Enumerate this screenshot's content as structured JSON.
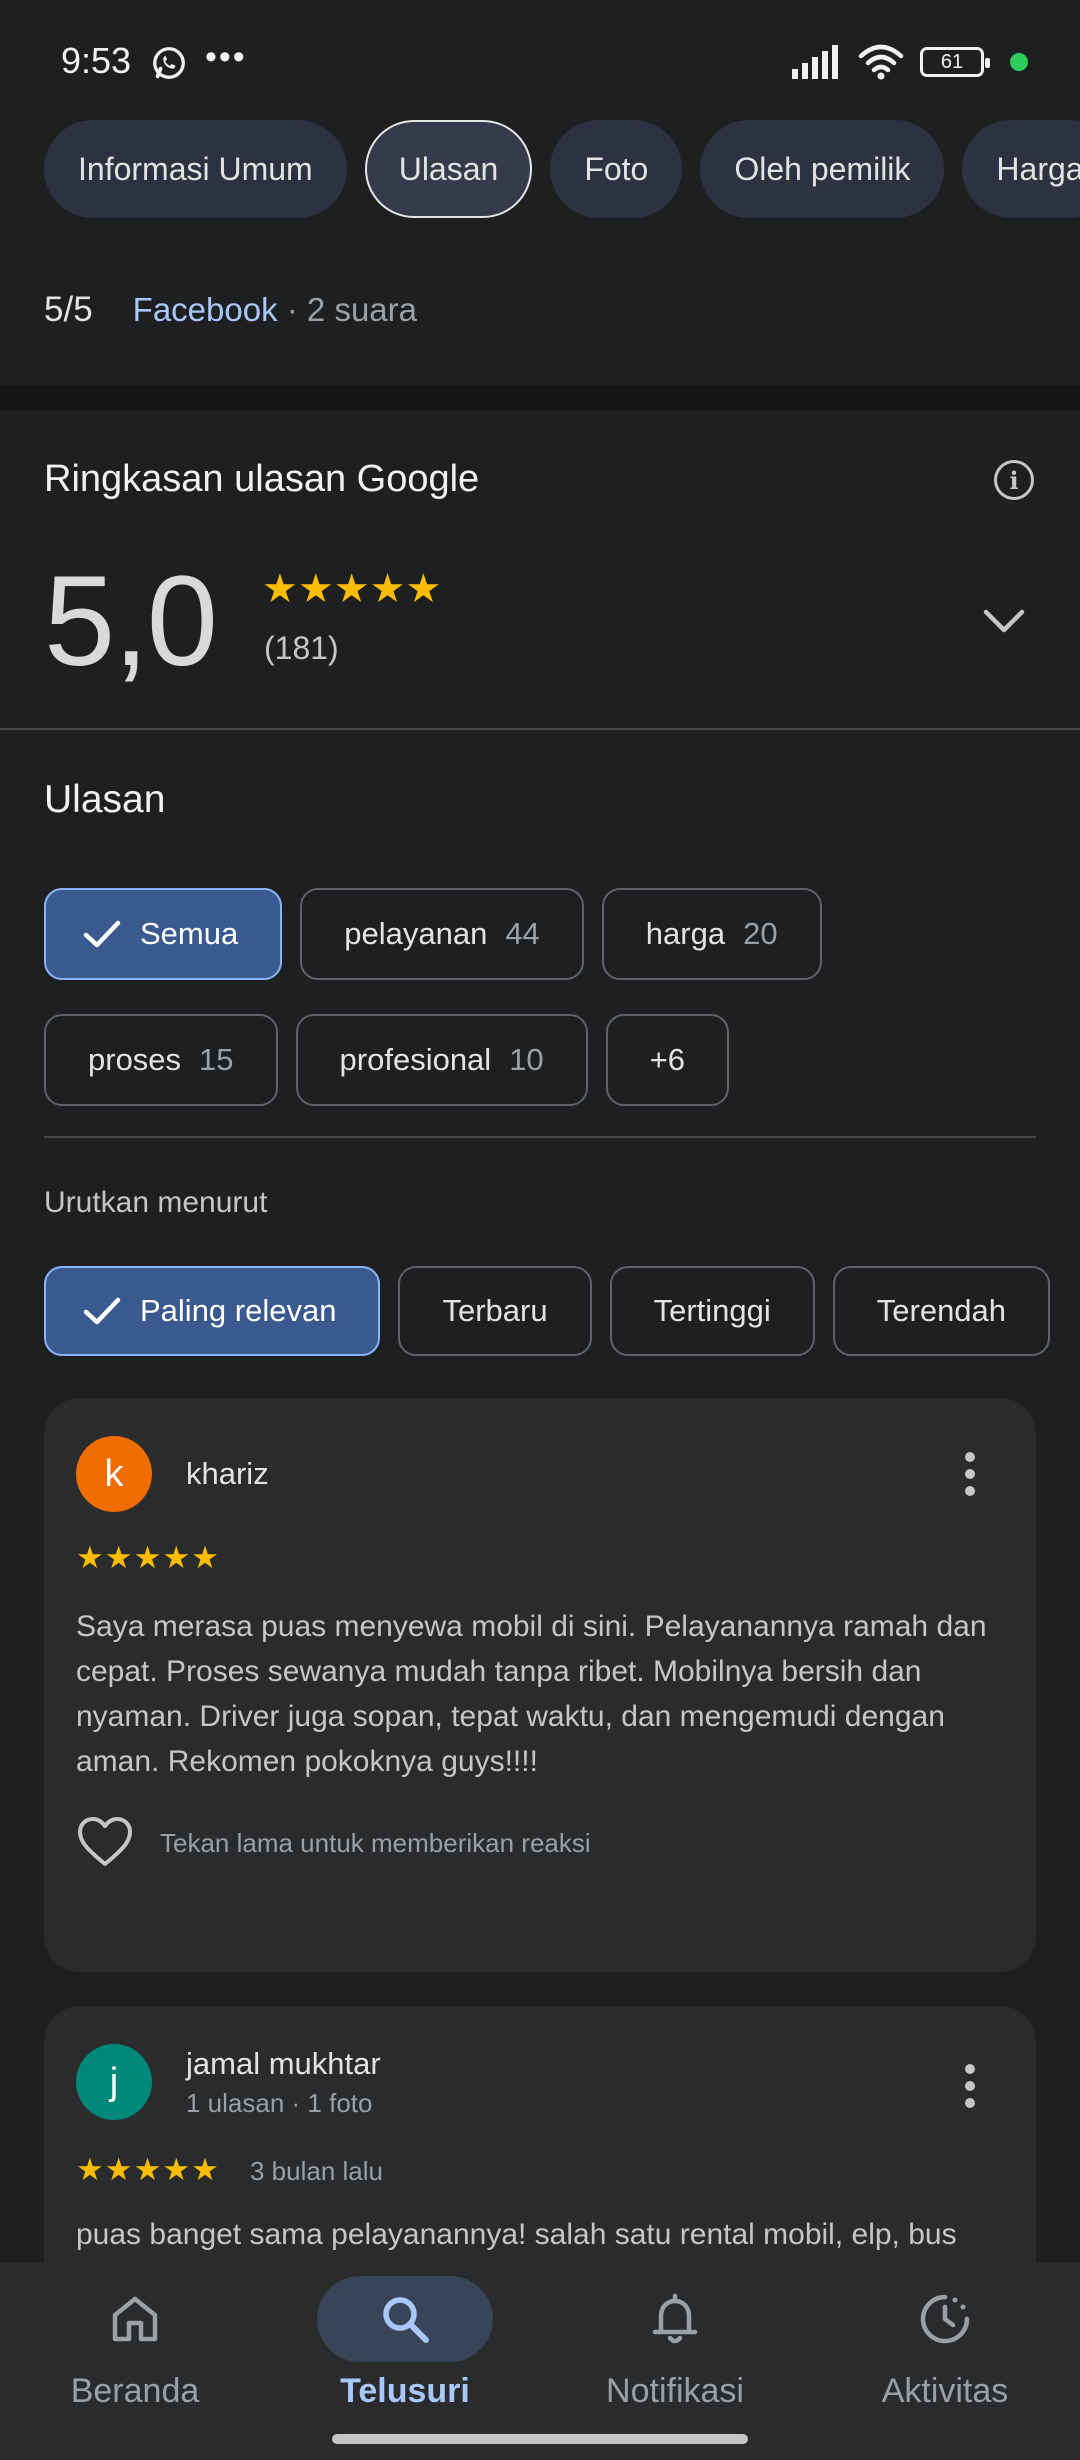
{
  "status": {
    "time": "9:53",
    "battery": "61"
  },
  "tabs": [
    {
      "label": "Informasi Umum"
    },
    {
      "label": "Ulasan"
    },
    {
      "label": "Foto"
    },
    {
      "label": "Oleh pemilik"
    },
    {
      "label": "Harga"
    }
  ],
  "external_rating": {
    "score": "5/5",
    "source": "Facebook",
    "votes": " · 2 suara"
  },
  "summary": {
    "title": "Ringkasan ulasan Google",
    "rating": "5,0",
    "stars": "★★★★★",
    "count": "(181)"
  },
  "reviews_section": {
    "title": "Ulasan",
    "topics": [
      {
        "label": "Semua",
        "count": ""
      },
      {
        "label": "pelayanan",
        "count": "44"
      },
      {
        "label": "harga",
        "count": "20"
      },
      {
        "label": "proses",
        "count": "15"
      },
      {
        "label": "profesional",
        "count": "10"
      },
      {
        "label": "+6",
        "count": ""
      }
    ],
    "sort_label": "Urutkan menurut",
    "sort_options": [
      {
        "label": "Paling relevan"
      },
      {
        "label": "Terbaru"
      },
      {
        "label": "Tertinggi"
      },
      {
        "label": "Terendah"
      }
    ]
  },
  "reviews": [
    {
      "initial": "k",
      "avatar_color": "#ef6c00",
      "name": "khariz",
      "stars": "★★★★★",
      "text": "Saya merasa puas menyewa mobil di sini. Pelayanannya ramah dan cepat. Proses sewanya mudah tanpa ribet. Mobilnya bersih dan nyaman. Driver juga sopan, tepat waktu, dan mengemudi dengan aman. Rekomen pokoknya guys!!!!",
      "react_hint": "Tekan lama untuk memberikan reaksi"
    },
    {
      "initial": "j",
      "avatar_color": "#00897b",
      "name": "jamal mukhtar",
      "meta": "1 ulasan · 1 foto",
      "stars": "★★★★★",
      "time": "3 bulan lalu",
      "text": "puas banget sama pelayanannya! salah satu rental mobil, elp, bus"
    }
  ],
  "bottom_nav": [
    {
      "label": "Beranda",
      "icon": "home-icon"
    },
    {
      "label": "Telusuri",
      "icon": "search-icon"
    },
    {
      "label": "Notifikasi",
      "icon": "bell-icon"
    },
    {
      "label": "Aktivitas",
      "icon": "activity-icon"
    }
  ],
  "colors": {
    "accent": "#a8c7fa",
    "star": "#fbbc04",
    "selected_chip": "#3a5a8f"
  }
}
